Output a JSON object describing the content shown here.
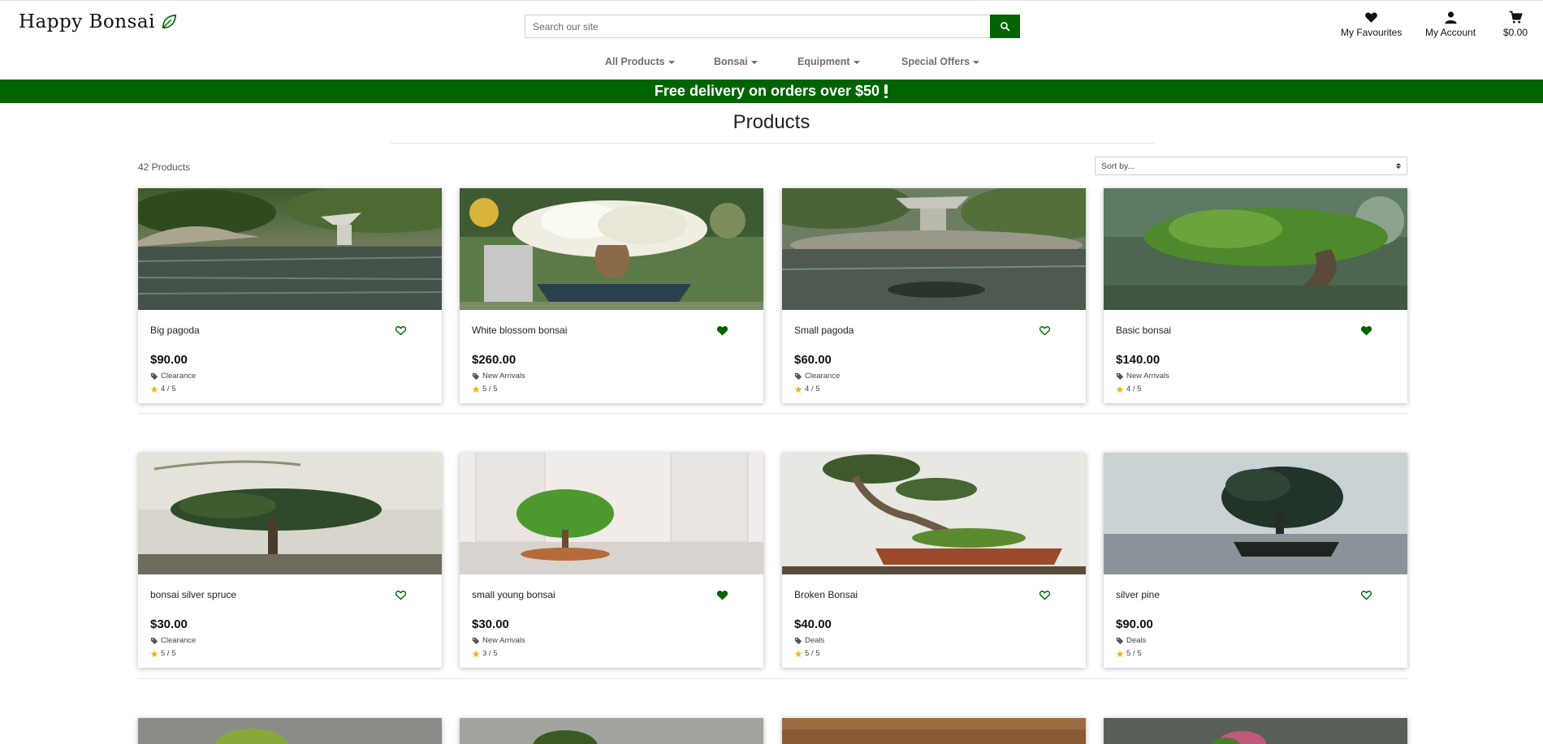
{
  "header": {
    "logo_text": "Happy Bonsai",
    "search_placeholder": "Search our site",
    "favourites_label": "My Favourites",
    "account_label": "My Account",
    "cart_total": "$0.00"
  },
  "menu": [
    {
      "label": "All Products"
    },
    {
      "label": "Bonsai"
    },
    {
      "label": "Equipment"
    },
    {
      "label": "Special Offers"
    }
  ],
  "banner": {
    "text": "Free delivery on orders over $50"
  },
  "page": {
    "title": "Products",
    "count": "42 Products",
    "sort_selected": "Sort by..."
  },
  "colors": {
    "brand_green": "#006400",
    "star": "#f5b400"
  },
  "products": [
    {
      "name": "Big pagoda",
      "price": "$90.00",
      "category": "Clearance",
      "rating": "4 / 5",
      "favourite": false
    },
    {
      "name": "White blossom bonsai",
      "price": "$260.00",
      "category": "New Arrivals",
      "rating": "5 / 5",
      "favourite": true
    },
    {
      "name": "Small pagoda",
      "price": "$60.00",
      "category": "Clearance",
      "rating": "4 / 5",
      "favourite": false
    },
    {
      "name": "Basic bonsai",
      "price": "$140.00",
      "category": "New Arrivals",
      "rating": "4 / 5",
      "favourite": true
    },
    {
      "name": "bonsai silver spruce",
      "price": "$30.00",
      "category": "Clearance",
      "rating": "5 / 5",
      "favourite": false
    },
    {
      "name": "small young bonsai",
      "price": "$30.00",
      "category": "New Arrivals",
      "rating": "3 / 5",
      "favourite": true
    },
    {
      "name": "Broken Bonsai",
      "price": "$40.00",
      "category": "Deals",
      "rating": "5 / 5",
      "favourite": false
    },
    {
      "name": "silver pine",
      "price": "$90.00",
      "category": "Deals",
      "rating": "5 / 5",
      "favourite": false
    }
  ]
}
